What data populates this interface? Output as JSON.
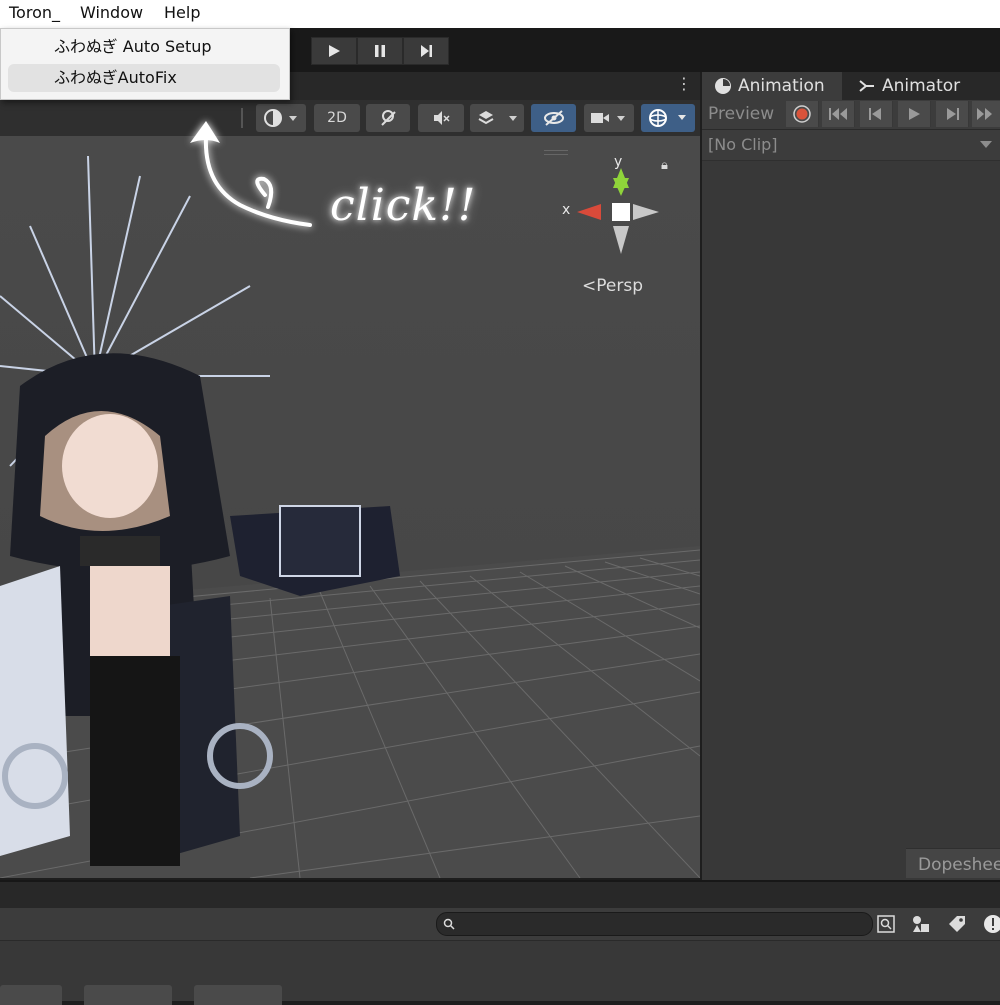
{
  "menubar": {
    "items": [
      "Toron_",
      "Window",
      "Help"
    ]
  },
  "dropdown": {
    "items": [
      "ふわぬぎ Auto Setup",
      "ふわぬぎAutoFix"
    ]
  },
  "scene": {
    "toolbar": {
      "mode_2d": "2D"
    },
    "gizmo": {
      "axis_y": "y",
      "axis_x": "x",
      "projection": "Persp"
    }
  },
  "annotation": {
    "text": "click!!"
  },
  "animation_panel": {
    "tabs": [
      "Animation",
      "Animator"
    ],
    "preview_label": "Preview",
    "clip_value": "[No Clip]",
    "dopesheet_label": "Dopesheet"
  },
  "colors": {
    "accent_blue": "#3e5f87",
    "record_red": "#d9533a",
    "gizmo_green": "#8fd43a",
    "gizmo_red": "#d94a3a"
  }
}
